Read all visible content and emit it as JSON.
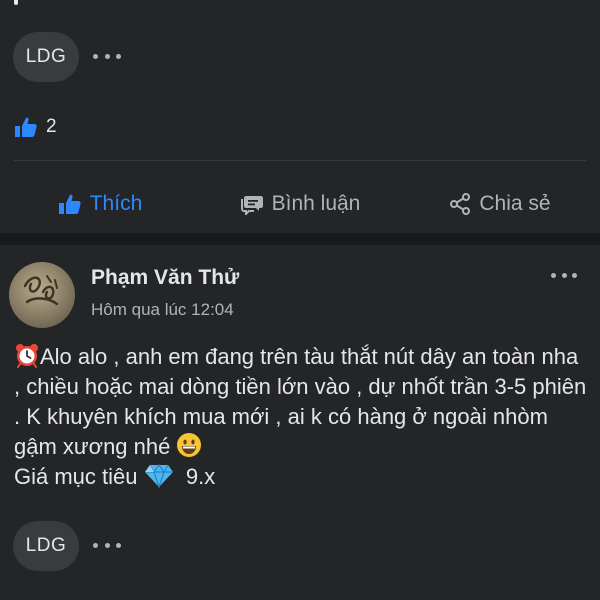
{
  "previous_post": {
    "comment_avatar_initials": "LDG",
    "reaction_count": "2",
    "actions": {
      "like": "Thích",
      "comment": "Bình luận",
      "share": "Chia sẻ"
    }
  },
  "post": {
    "author": "Phạm Văn Thử",
    "timestamp": "Hôm qua lúc 12:04",
    "body_lines": [
      "Alo alo , anh em đang trên tàu thắt nút dây an toàn nha , chiều hoặc mai dòng tiền lớn vào , dự nhốt trần 3-5 phiên . K khuyên khích mua mới , ai k có hàng ở ngoài nhòm gậm xương nhé",
      "Giá mục tiêu",
      "9.x"
    ],
    "comment_avatar_initials": "LDG"
  },
  "icons": {
    "like": "thumbs-up-icon",
    "comment": "comment-icon",
    "share": "share-icon",
    "more": "more-icon",
    "alarm": "alarm-clock-icon",
    "grin": "grinning-face-icon",
    "gem": "gem-icon"
  },
  "colors": {
    "background": "#242526",
    "separator": "#18191a",
    "chip": "#3a3b3c",
    "accent": "#2d88ff",
    "text": "#e4e6eb",
    "muted": "#b0b3b8"
  }
}
